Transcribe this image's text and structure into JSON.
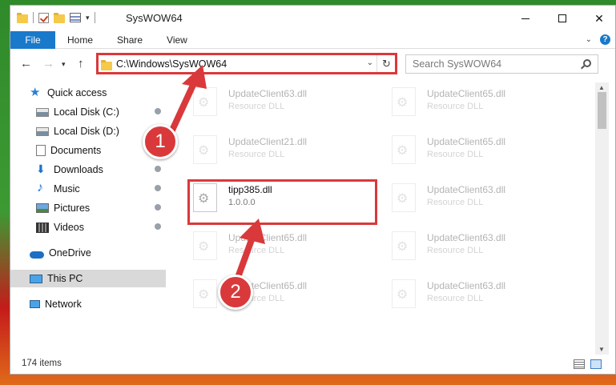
{
  "window": {
    "title": "SysWOW64"
  },
  "ribbon": {
    "file": "File",
    "tabs": [
      "Home",
      "Share",
      "View"
    ]
  },
  "address": {
    "path": "C:\\Windows\\SysWOW64"
  },
  "search": {
    "placeholder": "Search SysWOW64"
  },
  "sidebar": {
    "items": [
      {
        "label": "Quick access",
        "icon": "star-icon"
      },
      {
        "label": "Local Disk (C:)",
        "icon": "disk-icon",
        "pinned": true
      },
      {
        "label": "Local Disk (D:)",
        "icon": "disk-icon"
      },
      {
        "label": "Documents",
        "icon": "documents-icon"
      },
      {
        "label": "Downloads",
        "icon": "download-icon",
        "pinned": true
      },
      {
        "label": "Music",
        "icon": "music-icon",
        "pinned": true
      },
      {
        "label": "Pictures",
        "icon": "pictures-icon",
        "pinned": true
      },
      {
        "label": "Videos",
        "icon": "videos-icon",
        "pinned": true
      },
      {
        "label": "OneDrive",
        "icon": "cloud-icon"
      },
      {
        "label": "This PC",
        "icon": "computer-icon",
        "selected": true
      },
      {
        "label": "Network",
        "icon": "network-icon"
      }
    ]
  },
  "files": [
    {
      "name": "UpdateClient63.dll",
      "desc": "Resource DLL"
    },
    {
      "name": "UpdateClient65.dll",
      "desc": "Resource DLL"
    },
    {
      "name": "UpdateClient21.dll",
      "desc": "Resource DLL"
    },
    {
      "name": "UpdateClient65.dll",
      "desc": "Resource DLL"
    },
    {
      "name": "tipp385.dll",
      "desc": "1.0.0.0"
    },
    {
      "name": "UpdateClient63.dll",
      "desc": "Resource DLL"
    },
    {
      "name": "UpdateClient65.dll",
      "desc": "Resource DLL"
    },
    {
      "name": "UpdateClient63.dll",
      "desc": "Resource DLL"
    },
    {
      "name": "UpdateClient65.dll",
      "desc": "Resource DLL"
    },
    {
      "name": "UpdateClient63.dll",
      "desc": "Resource DLL"
    }
  ],
  "status": {
    "items": "174 items"
  },
  "annotations": {
    "step1": "1",
    "step2": "2"
  },
  "colors": {
    "accent": "#1979ca",
    "highlight": "#d9393b"
  }
}
